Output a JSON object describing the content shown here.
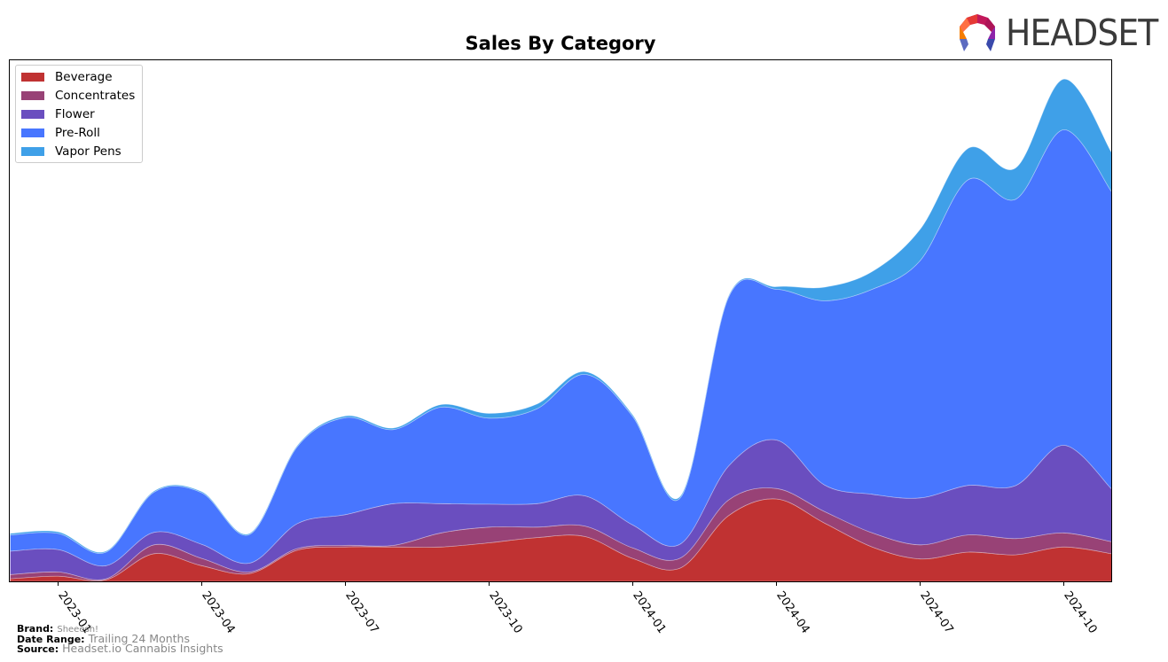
{
  "header": {
    "logo_text": "HEADSET"
  },
  "footer": {
    "brand_label": "Brand:",
    "brand_value": "Sheeesh!",
    "date_range_label": "Date Range:",
    "date_range_value": "Trailing 24 Months",
    "source_label": "Source:",
    "source_value": "Headset.io Cannabis Insights"
  },
  "colors": {
    "Beverage": "#c03232",
    "Concentrates": "#984276",
    "Flower": "#6a4ebf",
    "Pre-Roll": "#4876ff",
    "Vapor Pens": "#3fa0e8"
  },
  "chart_data": {
    "type": "area",
    "stacked": true,
    "title": "Sales By Category",
    "xlabel": "",
    "ylabel": "",
    "yaxis_visible": false,
    "y_units": "relative (plot top = 100)",
    "ylim": [
      0,
      100
    ],
    "legend_position": "top-left",
    "grid": false,
    "x": [
      "2022-12",
      "2023-01",
      "2023-02",
      "2023-03",
      "2023-04",
      "2023-05",
      "2023-06",
      "2023-07",
      "2023-08",
      "2023-09",
      "2023-10",
      "2023-11",
      "2023-12",
      "2024-01",
      "2024-02",
      "2024-03",
      "2024-04",
      "2024-05",
      "2024-06",
      "2024-07",
      "2024-08",
      "2024-09",
      "2024-10",
      "2024-11"
    ],
    "x_ticks": [
      "2023-01",
      "2023-04",
      "2023-07",
      "2023-10",
      "2024-01",
      "2024-04",
      "2024-07",
      "2024-10"
    ],
    "series": [
      {
        "name": "Beverage",
        "values": [
          0.5,
          1.0,
          0.3,
          5.3,
          3.0,
          1.5,
          6.0,
          6.6,
          6.6,
          6.6,
          7.4,
          8.4,
          8.6,
          4.4,
          2.6,
          12.6,
          15.8,
          11.2,
          6.6,
          4.3,
          5.6,
          5.1,
          6.6,
          5.3
        ]
      },
      {
        "name": "Concentrates",
        "values": [
          0.8,
          0.8,
          0.2,
          1.7,
          1.4,
          0.3,
          0.3,
          0.3,
          0.3,
          2.7,
          3.0,
          2.0,
          2.0,
          2.0,
          1.9,
          3.0,
          2.0,
          2.2,
          2.7,
          2.7,
          3.3,
          3.1,
          2.7,
          2.3
        ]
      },
      {
        "name": "Flower",
        "values": [
          4.5,
          4.3,
          2.5,
          2.4,
          2.7,
          1.7,
          4.8,
          5.9,
          8.0,
          5.6,
          4.4,
          4.5,
          5.8,
          4.4,
          2.7,
          6.5,
          9.3,
          5.1,
          7.4,
          9.0,
          9.5,
          10.2,
          16.8,
          10.1
        ]
      },
      {
        "name": "Pre-Roll",
        "values": [
          3.1,
          3.1,
          2.6,
          7.7,
          9.9,
          5.5,
          14.8,
          18.6,
          14.2,
          18.5,
          16.5,
          18.2,
          23.3,
          20.8,
          8.9,
          32.4,
          28.9,
          35.3,
          39.3,
          45.5,
          58.6,
          54.9,
          60.5,
          57.0
        ]
      },
      {
        "name": "Vapor Pens",
        "values": [
          0.3,
          0.3,
          0.2,
          0.2,
          0.2,
          0.2,
          0.2,
          0.3,
          0.3,
          0.5,
          0.9,
          0.9,
          0.5,
          0.3,
          0.3,
          0.2,
          0.5,
          2.6,
          3.4,
          6.0,
          6.0,
          6.0,
          9.7,
          7.5
        ]
      }
    ]
  }
}
